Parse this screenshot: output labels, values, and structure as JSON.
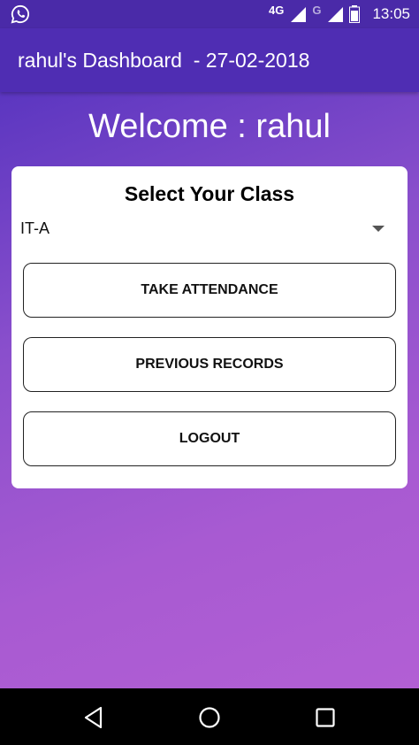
{
  "status_bar": {
    "network_4g": "4G",
    "network_g": "G",
    "time": "13:05",
    "notification_icon": "whatsapp-icon"
  },
  "app_bar": {
    "title": "rahul's Dashboard  - 27-02-2018"
  },
  "welcome": {
    "text": "Welcome : rahul"
  },
  "card": {
    "title": "Select Your Class",
    "selected_class": "IT-A",
    "buttons": {
      "take_attendance": "TAKE ATTENDANCE",
      "previous_records": "PREVIOUS RECORDS",
      "logout": "LOGOUT"
    }
  },
  "nav_bar": {
    "icons": [
      "back-icon",
      "home-icon",
      "recents-icon"
    ]
  },
  "colors": {
    "app_bar": "#4f2db3",
    "gradient_start": "#5b36c0",
    "gradient_end": "#b25fd4"
  }
}
